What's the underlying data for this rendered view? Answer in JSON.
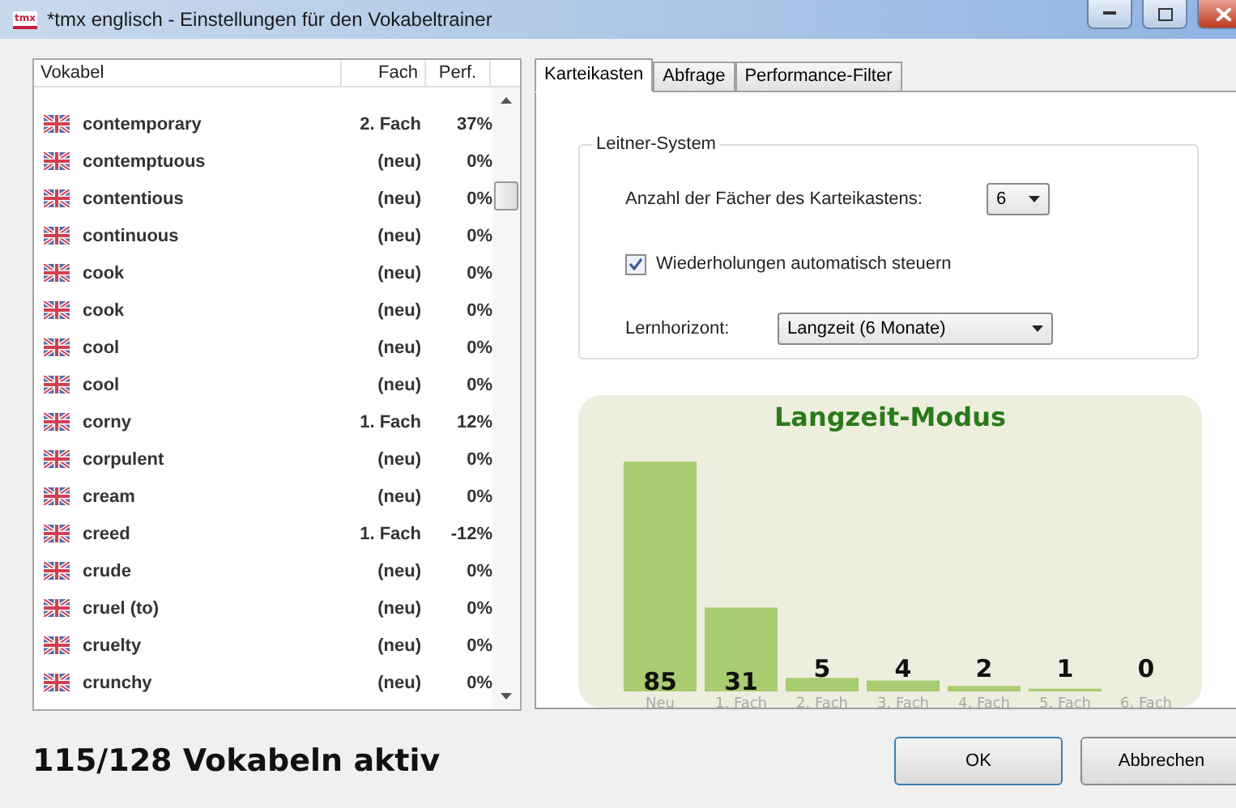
{
  "window": {
    "icon_text": "tmx",
    "title": "*tmx englisch - Einstellungen für den Vokabeltrainer"
  },
  "list": {
    "columns": [
      "Vokabel",
      "Fach",
      "Perf."
    ],
    "rows": [
      {
        "word": "contemporary",
        "fach": "2. Fach",
        "perf": "37%"
      },
      {
        "word": "contemptuous",
        "fach": "(neu)",
        "perf": "0%"
      },
      {
        "word": "contentious",
        "fach": "(neu)",
        "perf": "0%"
      },
      {
        "word": "continuous",
        "fach": "(neu)",
        "perf": "0%"
      },
      {
        "word": "cook",
        "fach": "(neu)",
        "perf": "0%"
      },
      {
        "word": "cook",
        "fach": "(neu)",
        "perf": "0%"
      },
      {
        "word": "cool",
        "fach": "(neu)",
        "perf": "0%"
      },
      {
        "word": "cool",
        "fach": "(neu)",
        "perf": "0%"
      },
      {
        "word": "corny",
        "fach": "1. Fach",
        "perf": "12%"
      },
      {
        "word": "corpulent",
        "fach": "(neu)",
        "perf": "0%"
      },
      {
        "word": "cream",
        "fach": "(neu)",
        "perf": "0%"
      },
      {
        "word": "creed",
        "fach": "1. Fach",
        "perf": "-12%"
      },
      {
        "word": "crude",
        "fach": "(neu)",
        "perf": "0%"
      },
      {
        "word": "cruel (to)",
        "fach": "(neu)",
        "perf": "0%"
      },
      {
        "word": "cruelty",
        "fach": "(neu)",
        "perf": "0%"
      },
      {
        "word": "crunchy",
        "fach": "(neu)",
        "perf": "0%"
      }
    ]
  },
  "tabs": [
    {
      "label": "Karteikasten",
      "selected": true
    },
    {
      "label": "Abfrage",
      "selected": false
    },
    {
      "label": "Performance-Filter",
      "selected": false
    }
  ],
  "leitner": {
    "title": "Leitner-System",
    "faecher_label": "Anzahl der Fächer des Karteikastens:",
    "faecher_value": "6",
    "auto_label": "Wiederholungen automatisch steuern",
    "auto_checked": true,
    "horizont_label": "Lernhorizont:",
    "horizont_value": "Langzeit (6 Monate)"
  },
  "mode_panel": {
    "chart_data": {
      "type": "bar",
      "title": "Langzeit-Modus",
      "categories": [
        "Neu",
        "1. Fach",
        "2. Fach",
        "3. Fach",
        "4. Fach",
        "5. Fach",
        "6. Fach"
      ],
      "data_labels": true,
      "series": [
        {
          "color": "#a8cc70",
          "values": [
            85,
            31,
            5,
            4,
            2,
            1,
            0
          ]
        }
      ]
    }
  },
  "status": "115/128 Vokabeln aktiv",
  "buttons": [
    "OK",
    "Abbrechen"
  ]
}
